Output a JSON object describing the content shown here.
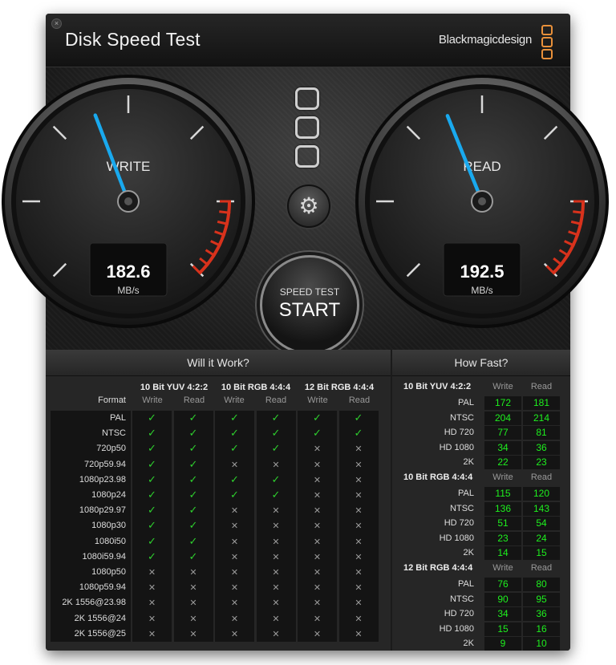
{
  "app": {
    "title": "Disk Speed Test",
    "brand": "Blackmagicdesign",
    "close_glyph": "×"
  },
  "gauges": {
    "write": {
      "label": "WRITE",
      "value": "182.6",
      "unit": "MB/s"
    },
    "read": {
      "label": "READ",
      "value": "192.5",
      "unit": "MB/s"
    }
  },
  "start_button": {
    "line1": "SPEED TEST",
    "line2": "START"
  },
  "settings": {
    "icon": "gear-icon"
  },
  "will_it_work": {
    "title": "Will it Work?",
    "format_label": "Format",
    "groups": [
      "10 Bit YUV 4:2:2",
      "10 Bit RGB 4:4:4",
      "12 Bit RGB 4:4:4"
    ],
    "sub": [
      "Write",
      "Read"
    ],
    "rows": [
      {
        "name": "PAL",
        "v": [
          1,
          1,
          1,
          1,
          1,
          1
        ]
      },
      {
        "name": "NTSC",
        "v": [
          1,
          1,
          1,
          1,
          1,
          1
        ]
      },
      {
        "name": "720p50",
        "v": [
          1,
          1,
          1,
          1,
          0,
          0
        ]
      },
      {
        "name": "720p59.94",
        "v": [
          1,
          1,
          0,
          0,
          0,
          0
        ]
      },
      {
        "name": "1080p23.98",
        "v": [
          1,
          1,
          1,
          1,
          0,
          0
        ]
      },
      {
        "name": "1080p24",
        "v": [
          1,
          1,
          1,
          1,
          0,
          0
        ]
      },
      {
        "name": "1080p29.97",
        "v": [
          1,
          1,
          0,
          0,
          0,
          0
        ]
      },
      {
        "name": "1080p30",
        "v": [
          1,
          1,
          0,
          0,
          0,
          0
        ]
      },
      {
        "name": "1080i50",
        "v": [
          1,
          1,
          0,
          0,
          0,
          0
        ]
      },
      {
        "name": "1080i59.94",
        "v": [
          1,
          1,
          0,
          0,
          0,
          0
        ]
      },
      {
        "name": "1080p50",
        "v": [
          0,
          0,
          0,
          0,
          0,
          0
        ]
      },
      {
        "name": "1080p59.94",
        "v": [
          0,
          0,
          0,
          0,
          0,
          0
        ]
      },
      {
        "name": "2K 1556@23.98",
        "v": [
          0,
          0,
          0,
          0,
          0,
          0
        ]
      },
      {
        "name": "2K 1556@24",
        "v": [
          0,
          0,
          0,
          0,
          0,
          0
        ]
      },
      {
        "name": "2K 1556@25",
        "v": [
          0,
          0,
          0,
          0,
          0,
          0
        ]
      }
    ],
    "check": "✓",
    "cross": "✕"
  },
  "how_fast": {
    "title": "How Fast?",
    "sub": [
      "Write",
      "Read"
    ],
    "groups": [
      {
        "name": "10 Bit YUV 4:2:2",
        "rows": [
          {
            "label": "PAL",
            "w": "172",
            "r": "181"
          },
          {
            "label": "NTSC",
            "w": "204",
            "r": "214"
          },
          {
            "label": "HD 720",
            "w": "77",
            "r": "81"
          },
          {
            "label": "HD 1080",
            "w": "34",
            "r": "36"
          },
          {
            "label": "2K",
            "w": "22",
            "r": "23"
          }
        ]
      },
      {
        "name": "10 Bit RGB 4:4:4",
        "rows": [
          {
            "label": "PAL",
            "w": "115",
            "r": "120"
          },
          {
            "label": "NTSC",
            "w": "136",
            "r": "143"
          },
          {
            "label": "HD 720",
            "w": "51",
            "r": "54"
          },
          {
            "label": "HD 1080",
            "w": "23",
            "r": "24"
          },
          {
            "label": "2K",
            "w": "14",
            "r": "15"
          }
        ]
      },
      {
        "name": "12 Bit RGB 4:4:4",
        "rows": [
          {
            "label": "PAL",
            "w": "76",
            "r": "80"
          },
          {
            "label": "NTSC",
            "w": "90",
            "r": "95"
          },
          {
            "label": "HD 720",
            "w": "34",
            "r": "36"
          },
          {
            "label": "HD 1080",
            "w": "15",
            "r": "16"
          },
          {
            "label": "2K",
            "w": "9",
            "r": "10"
          }
        ]
      }
    ]
  },
  "colors": {
    "accent": "#e8903a",
    "needle": "#19a9ee",
    "redzone": "#d8321c",
    "ok": "#2ecf2e",
    "speed": "#1ef01e"
  }
}
